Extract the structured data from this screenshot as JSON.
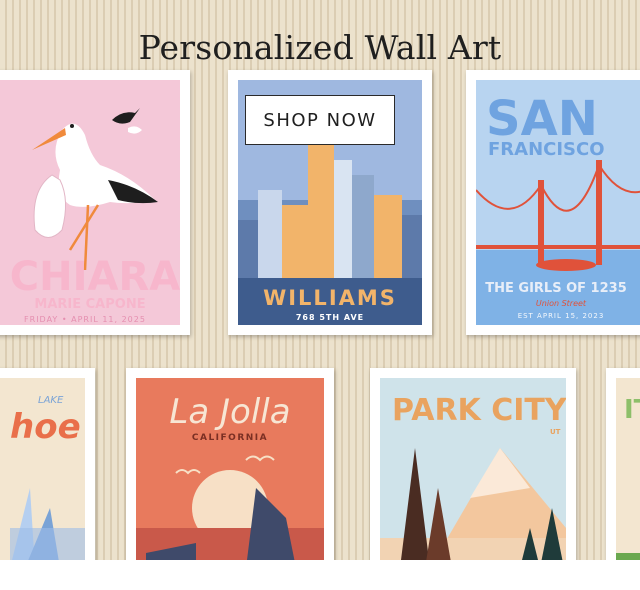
{
  "hero": {
    "headline": "Personalized Wall Art",
    "cta_label": "SHOP NOW"
  },
  "posters": {
    "chiara": {
      "name": "CHIARA",
      "subtitle": "MARIE CAPONE",
      "date": "FRIDAY • APRIL 11, 2025"
    },
    "williams": {
      "name": "WILLIAMS",
      "address": "768 5TH AVE"
    },
    "san_francisco": {
      "title_line1": "SAN",
      "title_line2": "FRANCISCO",
      "caption": "THE GIRLS OF 1235",
      "street": "Union Street",
      "est": "EST APRIL 15, 2023"
    },
    "tahoe": {
      "small": "LAKE",
      "title": "hoe"
    },
    "la_jolla": {
      "title": "La Jolla",
      "subtitle": "CALIFORNIA"
    },
    "park_city": {
      "title": "PARK CITY",
      "state": "UT"
    },
    "partial_right": {
      "title": "IT"
    }
  },
  "colors": {
    "wall_stripe_light": "#ece2cd",
    "wall_stripe_dark": "#dbcdb3",
    "frame": "#ffffff",
    "chiara_bg": "#f4c8d8",
    "williams_sky": "#9fb8e0",
    "sf_sky": "#b8d4f0",
    "lajolla_bg": "#e87a5d",
    "parkcity_sky": "#cfe3ea"
  }
}
